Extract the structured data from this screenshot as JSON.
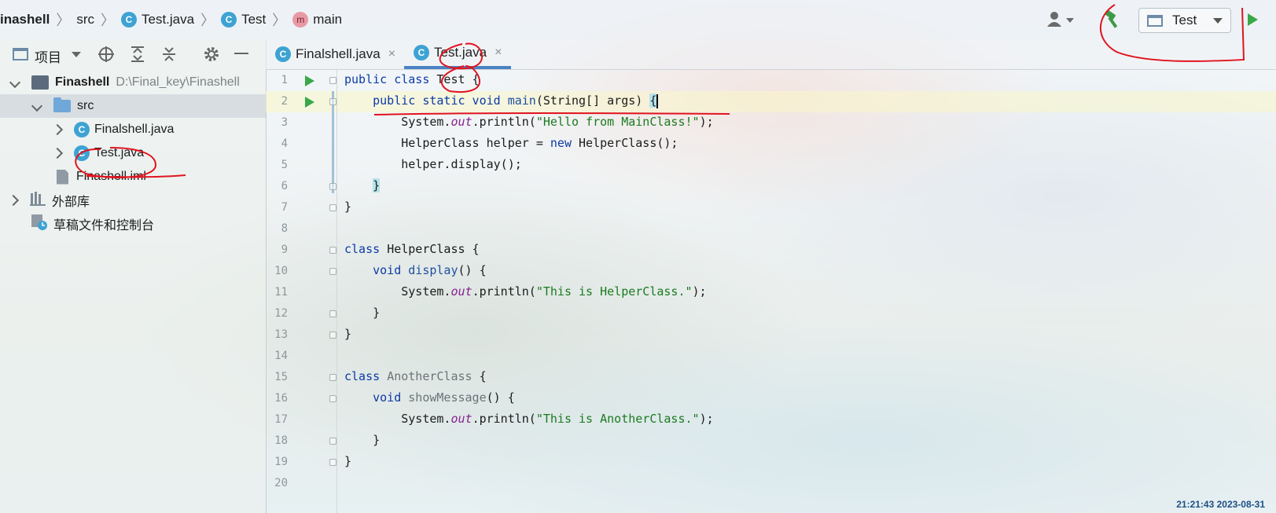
{
  "breadcrumb": {
    "project": "inashell",
    "folder": "src",
    "file": "Test.java",
    "class": "Test",
    "method": "main",
    "class_badge": "C",
    "method_badge": "m"
  },
  "run_config": {
    "label": "Test"
  },
  "project_panel": {
    "view_label": "项目",
    "tree": {
      "root_name": "Finashell",
      "root_path": "D:\\Final_key\\Finashell",
      "src": "src",
      "file1": "Finalshell.java",
      "file2": "Test.java",
      "iml": "Finashell.iml",
      "ext_libs": "外部库",
      "scratches": "草稿文件和控制台"
    }
  },
  "tabs": [
    {
      "label": "Finalshell.java",
      "close": "×"
    },
    {
      "label": "Test.java",
      "close": "×"
    }
  ],
  "line_numbers": [
    "1",
    "2",
    "3",
    "4",
    "5",
    "6",
    "7",
    "8",
    "9",
    "10",
    "11",
    "12",
    "13",
    "14",
    "15",
    "16",
    "17",
    "18",
    "19",
    "20"
  ],
  "code": {
    "l1_kw": "public class ",
    "l1_id": "Test",
    "l1_rest": " {",
    "l2_indent": "    ",
    "l2_kw": "public static void ",
    "l2_fn": "main",
    "l2_rest": "(String[] args) ",
    "l2_brace": "{",
    "l3_a": "        System.",
    "l3_f": "out",
    "l3_b": ".println(",
    "l3_s": "\"Hello from MainClass!\"",
    "l3_c": ");",
    "l4_a": "        HelperClass helper = ",
    "l4_kw": "new",
    "l4_b": " HelperClass();",
    "l5": "        helper.display();",
    "l6_indent": "    ",
    "l6_brace": "}",
    "l7": "}",
    "l9_kw": "class ",
    "l9_rest": "HelperClass {",
    "l10_indent": "    ",
    "l10_kw": "void ",
    "l10_fn": "display",
    "l10_rest": "() {",
    "l11_a": "        System.",
    "l11_f": "out",
    "l11_b": ".println(",
    "l11_s": "\"This is HelperClass.\"",
    "l11_c": ");",
    "l12": "    }",
    "l13": "}",
    "l15_kw": "class ",
    "l15_id": "AnotherClass",
    "l15_rest": " {",
    "l16_indent": "    ",
    "l16_kw": "void ",
    "l16_fn": "showMessage",
    "l16_rest": "() {",
    "l17_a": "        System.",
    "l17_f": "out",
    "l17_b": ".println(",
    "l17_s": "\"This is AnotherClass.\"",
    "l17_c": ");",
    "l18": "    }",
    "l19": "}"
  },
  "status": {
    "clock": "21:21:43 2023-08-31"
  },
  "colors": {
    "keyword": "#0c3aa6",
    "string": "#1a7a20",
    "field": "#86208f",
    "annotation": "#e0141e",
    "run": "#3aa84a"
  },
  "icons": [
    "class-icon",
    "method-icon",
    "user-icon",
    "build-hammer-icon",
    "window-icon",
    "run-icon",
    "locate-icon",
    "expand-all-icon",
    "collapse-all-icon",
    "gear-icon",
    "minimize-icon",
    "folder-icon",
    "file-icon",
    "library-icon",
    "scratch-icon",
    "close-icon"
  ]
}
